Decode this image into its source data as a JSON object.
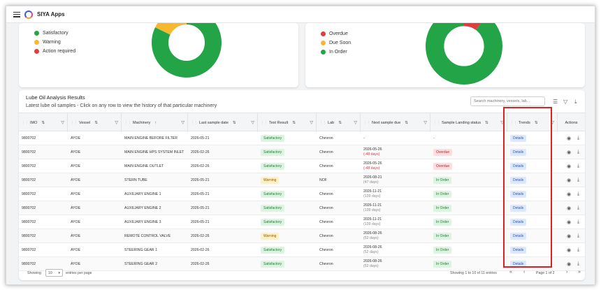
{
  "app": {
    "title": "SIYA Apps"
  },
  "left_panel": {
    "legend": [
      {
        "label": "Satisfactory",
        "color": "#22a447"
      },
      {
        "label": "Warning",
        "color": "#f5b82e"
      },
      {
        "label": "Action required",
        "color": "#e23c3c"
      }
    ],
    "donut": {
      "green_fraction": 0.82,
      "yellow_fraction": 0.18
    }
  },
  "right_panel": {
    "legend": [
      {
        "label": "Overdue",
        "color": "#e23c3c"
      },
      {
        "label": "Due Soon",
        "color": "#f5b82e"
      },
      {
        "label": "In Order",
        "color": "#22a447"
      }
    ],
    "donut": {
      "green_fraction": 0.9,
      "red_fraction": 0.1
    }
  },
  "results": {
    "title": "Lube Oil Analysis Results",
    "subtitle": "Latest lube oil samples - Click on any row to view the history of that particular machinery",
    "search_placeholder": "Search machinery, vessels, lab...",
    "columns": [
      "IMO",
      "Vessel",
      "Machinery",
      "Last sample date",
      "Test Result",
      "Lab",
      "Next sample due",
      "Sample Landing status",
      "Trends",
      "Actions"
    ],
    "rows": [
      {
        "imo": "9800702",
        "vessel": "AYOE",
        "machinery": "MAIN ENGINE BEFORE FILTER",
        "last": "2026-05-21",
        "result": "Satisfactory",
        "result_type": "green",
        "lab": "Chevron",
        "due": "-",
        "due_sub": "",
        "due_sub_red": false,
        "status": "-",
        "status_type": "",
        "trend": "Details"
      },
      {
        "imo": "9800702",
        "vessel": "AYOE",
        "machinery": "MAIN ENGINE HPS SYSTEM INLET",
        "last": "2026-02-26",
        "result": "Satisfactory",
        "result_type": "green",
        "lab": "Chevron",
        "due": "2026-05-26",
        "due_sub": "(-48 days)",
        "due_sub_red": true,
        "status": "Overdue",
        "status_type": "red",
        "trend": "Details"
      },
      {
        "imo": "9800702",
        "vessel": "AYOE",
        "machinery": "MAIN ENGINE OUTLET",
        "last": "2026-02-26",
        "result": "Satisfactory",
        "result_type": "green",
        "lab": "Chevron",
        "due": "2026-05-26",
        "due_sub": "(-48 days)",
        "due_sub_red": true,
        "status": "Overdue",
        "status_type": "red",
        "trend": "Details"
      },
      {
        "imo": "9800702",
        "vessel": "AYOE",
        "machinery": "STERN TUBE",
        "last": "2026-05-21",
        "result": "Warning",
        "result_type": "yellow",
        "lab": "NOF",
        "due": "2026-08-21",
        "due_sub": "(47 days)",
        "due_sub_red": false,
        "status": "In Order",
        "status_type": "green",
        "trend": "Details"
      },
      {
        "imo": "9800702",
        "vessel": "AYOE",
        "machinery": "AUXILIARY ENGINE 1",
        "last": "2026-05-21",
        "result": "Satisfactory",
        "result_type": "green",
        "lab": "Chevron",
        "due": "2026-11-21",
        "due_sub": "(139 days)",
        "due_sub_red": false,
        "status": "In Order",
        "status_type": "green",
        "trend": "Details"
      },
      {
        "imo": "9800702",
        "vessel": "AYOE",
        "machinery": "AUXILIARY ENGINE 2",
        "last": "2026-05-21",
        "result": "Satisfactory",
        "result_type": "green",
        "lab": "Chevron",
        "due": "2026-11-21",
        "due_sub": "(139 days)",
        "due_sub_red": false,
        "status": "In Order",
        "status_type": "green",
        "trend": "Details"
      },
      {
        "imo": "9800702",
        "vessel": "AYOE",
        "machinery": "AUXILIARY ENGINE 3",
        "last": "2026-05-21",
        "result": "Satisfactory",
        "result_type": "green",
        "lab": "Chevron",
        "due": "2026-11-21",
        "due_sub": "(139 days)",
        "due_sub_red": false,
        "status": "In Order",
        "status_type": "green",
        "trend": "Details"
      },
      {
        "imo": "9800702",
        "vessel": "AYOE",
        "machinery": "REMOTE CONTROL VALVE",
        "last": "2026-02-26",
        "result": "Warning",
        "result_type": "yellow",
        "lab": "Chevron",
        "due": "2026-08-26",
        "due_sub": "(52 days)",
        "due_sub_red": false,
        "status": "In Order",
        "status_type": "green",
        "trend": "Details"
      },
      {
        "imo": "9800702",
        "vessel": "AYOE",
        "machinery": "STEERING GEAR 1",
        "last": "2026-02-26",
        "result": "Satisfactory",
        "result_type": "green",
        "lab": "Chevron",
        "due": "2026-08-26",
        "due_sub": "(52 days)",
        "due_sub_red": false,
        "status": "In Order",
        "status_type": "green",
        "trend": "Details"
      },
      {
        "imo": "9800702",
        "vessel": "AYOE",
        "machinery": "STEERING GEAR 2",
        "last": "2026-02-26",
        "result": "Satisfactory",
        "result_type": "green",
        "lab": "Chevron",
        "due": "2026-08-26",
        "due_sub": "(52 days)",
        "due_sub_red": false,
        "status": "In Order",
        "status_type": "green",
        "trend": "Details"
      }
    ]
  },
  "footer": {
    "showing_label": "Showing",
    "page_size": "10",
    "per_page_label": "entries per page",
    "count_text": "Showing 1 to 10 of 11 entries",
    "page_text": "Page 1 of 2"
  }
}
